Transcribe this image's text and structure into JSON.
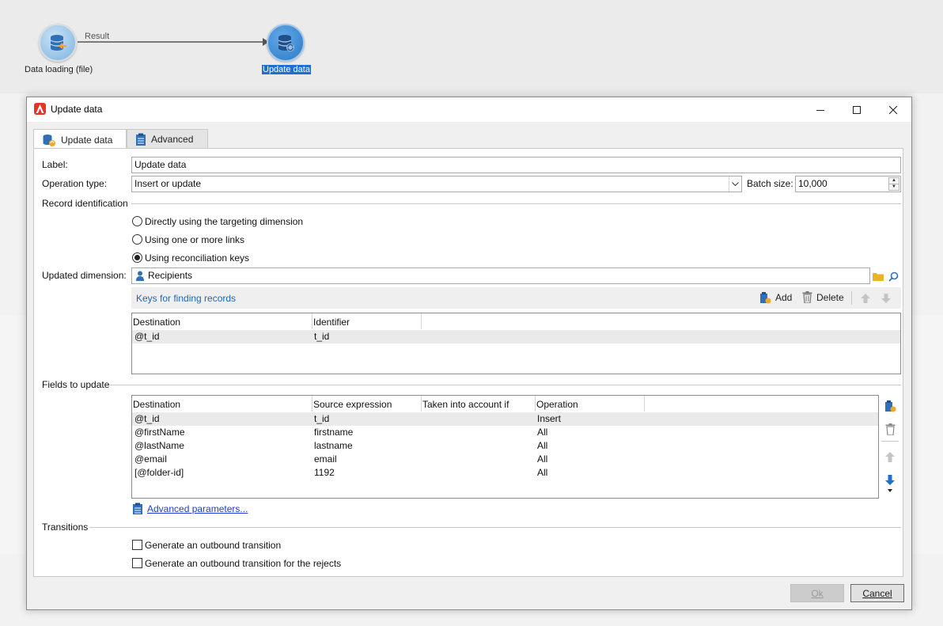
{
  "workflow": {
    "source_node": {
      "label": "Data loading (file)",
      "icon": "database-load-icon"
    },
    "target_node": {
      "label": "Update data",
      "icon": "database-update-icon"
    },
    "transition_label": "Result"
  },
  "dialog": {
    "title": "Update data",
    "window_buttons": {
      "minimize": "—",
      "maximize": "☐",
      "close": "✕"
    },
    "tabs": [
      {
        "label": "Update data",
        "icon": "database-update-icon"
      },
      {
        "label": "Advanced",
        "icon": "clipboard-icon"
      }
    ],
    "label_field": {
      "label": "Label:",
      "value": "Update data"
    },
    "operation_type": {
      "label": "Operation type:",
      "value": "Insert or update"
    },
    "batch_size": {
      "label": "Batch size:",
      "value": "10,000"
    },
    "record_identification": {
      "title": "Record identification",
      "options": [
        {
          "label": "Directly using the targeting dimension",
          "checked": false
        },
        {
          "label": "Using one or more links",
          "checked": false
        },
        {
          "label": "Using reconciliation keys",
          "checked": true
        }
      ]
    },
    "updated_dimension": {
      "label": "Updated dimension:",
      "value": "Recipients"
    },
    "keys": {
      "title": "Keys for finding records",
      "add_label": "Add",
      "delete_label": "Delete",
      "columns": [
        "Destination",
        "Identifier"
      ],
      "rows": [
        {
          "destination": "@t_id",
          "identifier": "t_id"
        }
      ]
    },
    "fields": {
      "title": "Fields to update",
      "columns": [
        "Destination",
        "Source expression",
        "Taken into account if",
        "Operation"
      ],
      "rows": [
        {
          "destination": "@t_id",
          "source": "t_id",
          "condition": "",
          "operation": "Insert"
        },
        {
          "destination": "@firstName",
          "source": "firstname",
          "condition": "",
          "operation": "All"
        },
        {
          "destination": "@lastName",
          "source": "lastname",
          "condition": "",
          "operation": "All"
        },
        {
          "destination": "@email",
          "source": "email",
          "condition": "",
          "operation": "All"
        },
        {
          "destination": "[@folder-id]",
          "source": "1192",
          "condition": "",
          "operation": "All"
        }
      ]
    },
    "advanced_parameters_link": "Advanced parameters...",
    "transitions": {
      "title": "Transitions",
      "options": [
        {
          "label": "Generate an outbound transition",
          "checked": false
        },
        {
          "label": "Generate an outbound transition for the rejects",
          "checked": false
        }
      ]
    },
    "ok_label": "Ok",
    "cancel_label": "Cancel"
  },
  "colors": {
    "accent": "#1f67b5",
    "selection": "#1e6fd0",
    "link": "#1f3fd1",
    "app_icon": "#e8332a"
  }
}
